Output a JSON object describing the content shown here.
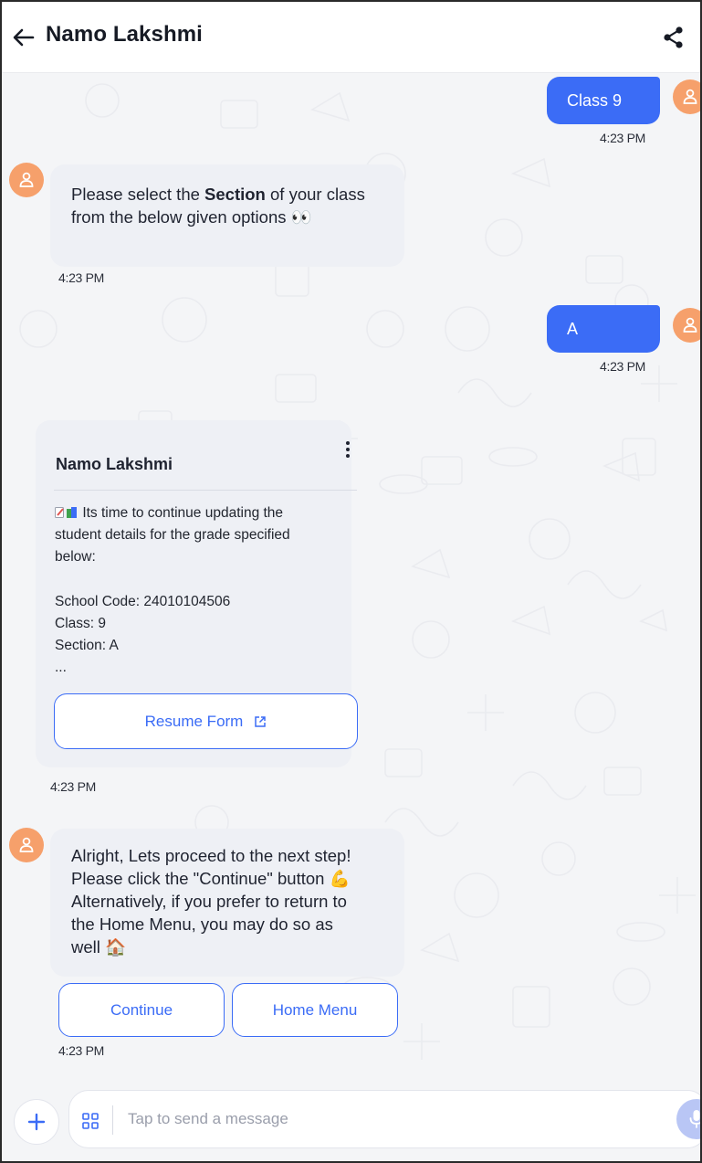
{
  "header": {
    "title": "Namo Lakshmi",
    "back_icon": "arrow-left-icon",
    "share_icon": "share-icon"
  },
  "messages": {
    "class_reply": {
      "text": "Class 9",
      "time": "4:23 PM"
    },
    "section_prompt": {
      "prefix": "Please select the ",
      "bold": "Section",
      "suffix": " of your class from the below given options 👀",
      "time": "4:23 PM"
    },
    "section_reply": {
      "text": "A",
      "time": "4:23 PM"
    },
    "form_card": {
      "title": "Namo Lakshmi",
      "lines": [
        "Its time to continue updating the",
        "student details for the grade specified",
        "below:",
        "",
        "School Code: 24010104506",
        "Class: 9",
        "Section: A",
        "..."
      ],
      "button_label": "Resume Form",
      "time": "4:23 PM"
    },
    "proceed_prompt": {
      "line1": "Alright, Lets proceed to the next step!",
      "line2": "Please click the \"Continue\" button 💪",
      "line3": "Alternatively, if you prefer to return to",
      "line4": "the Home Menu, you may do so as",
      "line5": "well 🏠",
      "time": "4:23 PM"
    },
    "quick_replies": [
      "Continue",
      "Home Menu"
    ]
  },
  "composer": {
    "placeholder": "Tap to send a message"
  },
  "colors": {
    "accent": "#3b6cf6",
    "avatar": "#f6a06b",
    "bubble_in": "#eef0f5",
    "chat_bg": "#f4f5f7"
  }
}
